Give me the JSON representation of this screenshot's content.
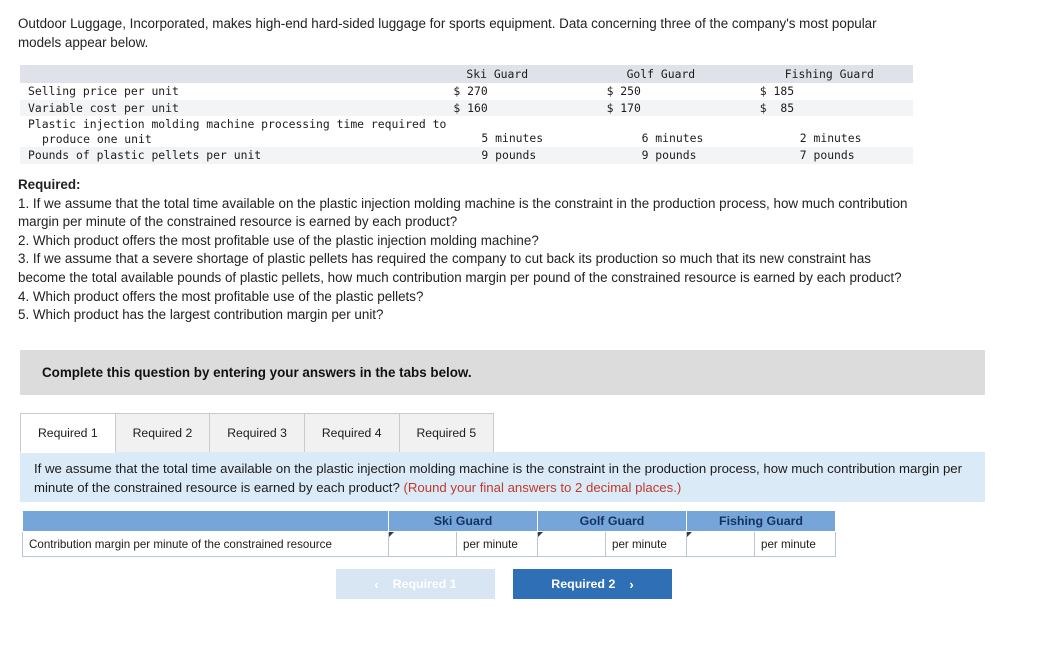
{
  "intro": {
    "paragraph": "Outdoor Luggage, Incorporated, makes high-end hard-sided luggage for sports equipment. Data concerning three of the company's most popular models appear below."
  },
  "data_table": {
    "columns": [
      "",
      "Ski Guard",
      "Golf Guard",
      "Fishing Guard"
    ],
    "rows": [
      {
        "label": "Selling price per unit",
        "label_line2": "",
        "ski": "$ 270",
        "golf": "$ 250",
        "fishing": "$ 185"
      },
      {
        "label": "Variable cost per unit",
        "label_line2": "",
        "ski": "$ 160",
        "golf": "$ 170",
        "fishing": "$  85"
      },
      {
        "label": "Plastic injection molding machine processing time required to",
        "label_line2": "produce one unit",
        "ski": "5 minutes",
        "golf": "6 minutes",
        "fishing": "2 minutes"
      },
      {
        "label": "Pounds of plastic pellets per unit",
        "label_line2": "",
        "ski": "9 pounds",
        "golf": "9 pounds",
        "fishing": "7 pounds"
      }
    ]
  },
  "required": {
    "title": "Required:",
    "items": [
      "1. If we assume that the total time available on the plastic injection molding machine is the constraint in the production process, how much contribution margin per minute of the constrained resource is earned by each product?",
      "2. Which product offers the most profitable use of the plastic injection molding machine?",
      "3. If we assume that a severe shortage of plastic pellets has required the company to cut back its production so much that its new constraint has become the total available pounds of plastic pellets, how much contribution margin per pound of the constrained resource is earned by each product?",
      "4. Which product offers the most profitable use of the plastic pellets?",
      "5. Which product has the largest contribution margin per unit?"
    ]
  },
  "instruction_bar": {
    "text": "Complete this question by entering your answers in the tabs below."
  },
  "tabs": {
    "active_index": 0,
    "items": [
      {
        "label": "Required 1"
      },
      {
        "label": "Required 2"
      },
      {
        "label": "Required 3"
      },
      {
        "label": "Required 4"
      },
      {
        "label": "Required 5"
      }
    ]
  },
  "question_panel": {
    "text": "If we assume that the total time available on the plastic injection molding machine is the constraint in the production process, how much contribution margin per minute of the constrained resource is earned by each product?",
    "hint": "(Round your final answers to 2 decimal places.)"
  },
  "answer_table": {
    "headers": [
      "",
      "Ski Guard",
      "Golf Guard",
      "Fishing Guard"
    ],
    "row_label": "Contribution margin per minute of the constrained resource",
    "cells": [
      {
        "value": "",
        "unit": "per minute"
      },
      {
        "value": "",
        "unit": "per minute"
      },
      {
        "value": "",
        "unit": "per minute"
      }
    ]
  },
  "nav": {
    "prev_label": "Required 1",
    "next_label": "Required 2",
    "prev_icon": "chevron-left-icon",
    "next_icon": "chevron-right-icon",
    "prev_chevron": "‹",
    "next_chevron": "›"
  },
  "colors": {
    "header_blue": "#76a5da",
    "panel_blue": "#dbeaf7",
    "button_blue": "#2f6fb5",
    "button_disabled": "#d8e5f2",
    "gray_bar": "#dcdcdc",
    "hint_red": "#c0392b"
  }
}
